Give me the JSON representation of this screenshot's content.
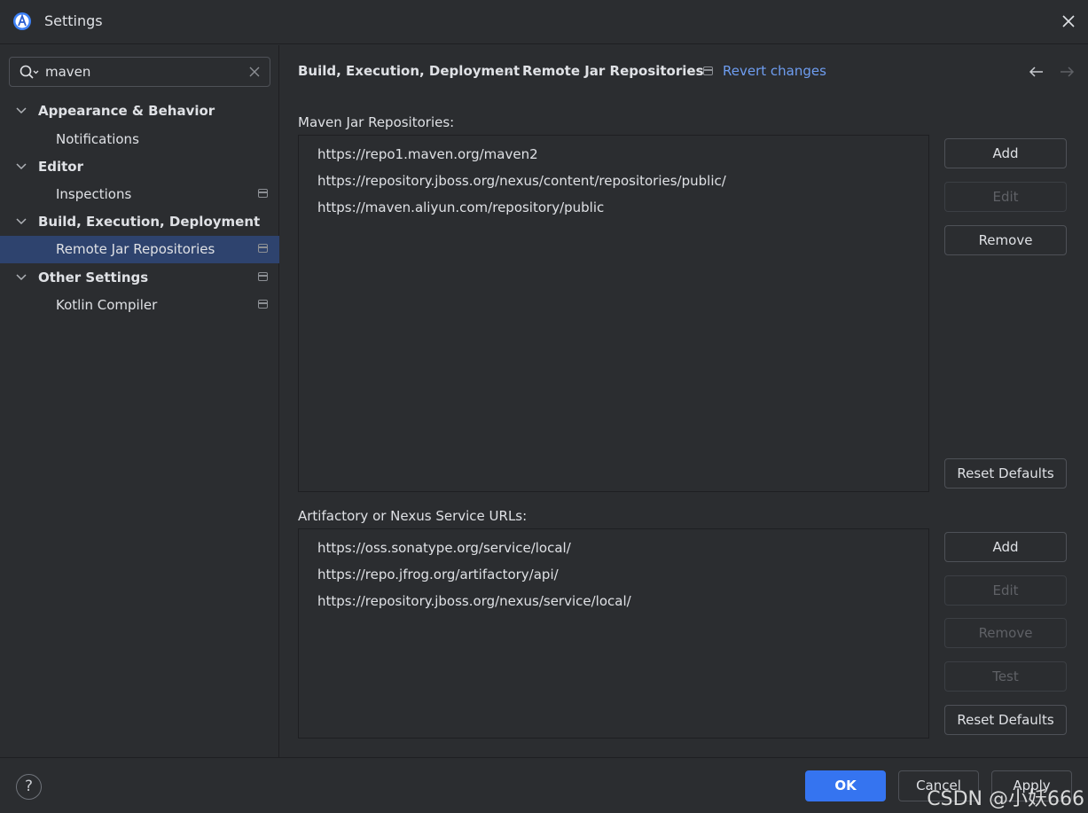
{
  "window": {
    "title": "Settings"
  },
  "search": {
    "value": "maven"
  },
  "tree": [
    {
      "label": "Appearance & Behavior",
      "level": 0,
      "expanded": true
    },
    {
      "label": "Notifications",
      "level": 1
    },
    {
      "label": "Editor",
      "level": 0,
      "expanded": true
    },
    {
      "label": "Inspections",
      "level": 1,
      "project_icon": true
    },
    {
      "label": "Build, Execution, Deployment",
      "level": 0,
      "expanded": true
    },
    {
      "label": "Remote Jar Repositories",
      "level": 1,
      "selected": true,
      "project_icon": true
    },
    {
      "label": "Other Settings",
      "level": 0,
      "expanded": true,
      "project_icon": true
    },
    {
      "label": "Kotlin Compiler",
      "level": 1,
      "project_icon": true
    }
  ],
  "breadcrumb": {
    "parent": "Build, Execution, Deployment",
    "separator": "›",
    "current": "Remote Jar Repositories",
    "revert": "Revert changes"
  },
  "maven": {
    "label": "Maven Jar Repositories:",
    "items": [
      "https://repo1.maven.org/maven2",
      "https://repository.jboss.org/nexus/content/repositories/public/",
      "https://maven.aliyun.com/repository/public"
    ],
    "buttons": {
      "add": "Add",
      "edit": "Edit",
      "remove": "Remove",
      "reset": "Reset Defaults"
    }
  },
  "artifactory": {
    "label": "Artifactory or Nexus Service URLs:",
    "items": [
      "https://oss.sonatype.org/service/local/",
      "https://repo.jfrog.org/artifactory/api/",
      "https://repository.jboss.org/nexus/service/local/"
    ],
    "buttons": {
      "add": "Add",
      "edit": "Edit",
      "remove": "Remove",
      "test": "Test",
      "reset": "Reset Defaults"
    }
  },
  "footer": {
    "help": "?",
    "ok": "OK",
    "cancel": "Cancel",
    "apply": "Apply",
    "watermark": "CSDN @小妖666"
  },
  "colors": {
    "accent": "#3574f0",
    "link": "#6e9df0",
    "selection": "#2e436e",
    "background": "#2b2d30"
  }
}
